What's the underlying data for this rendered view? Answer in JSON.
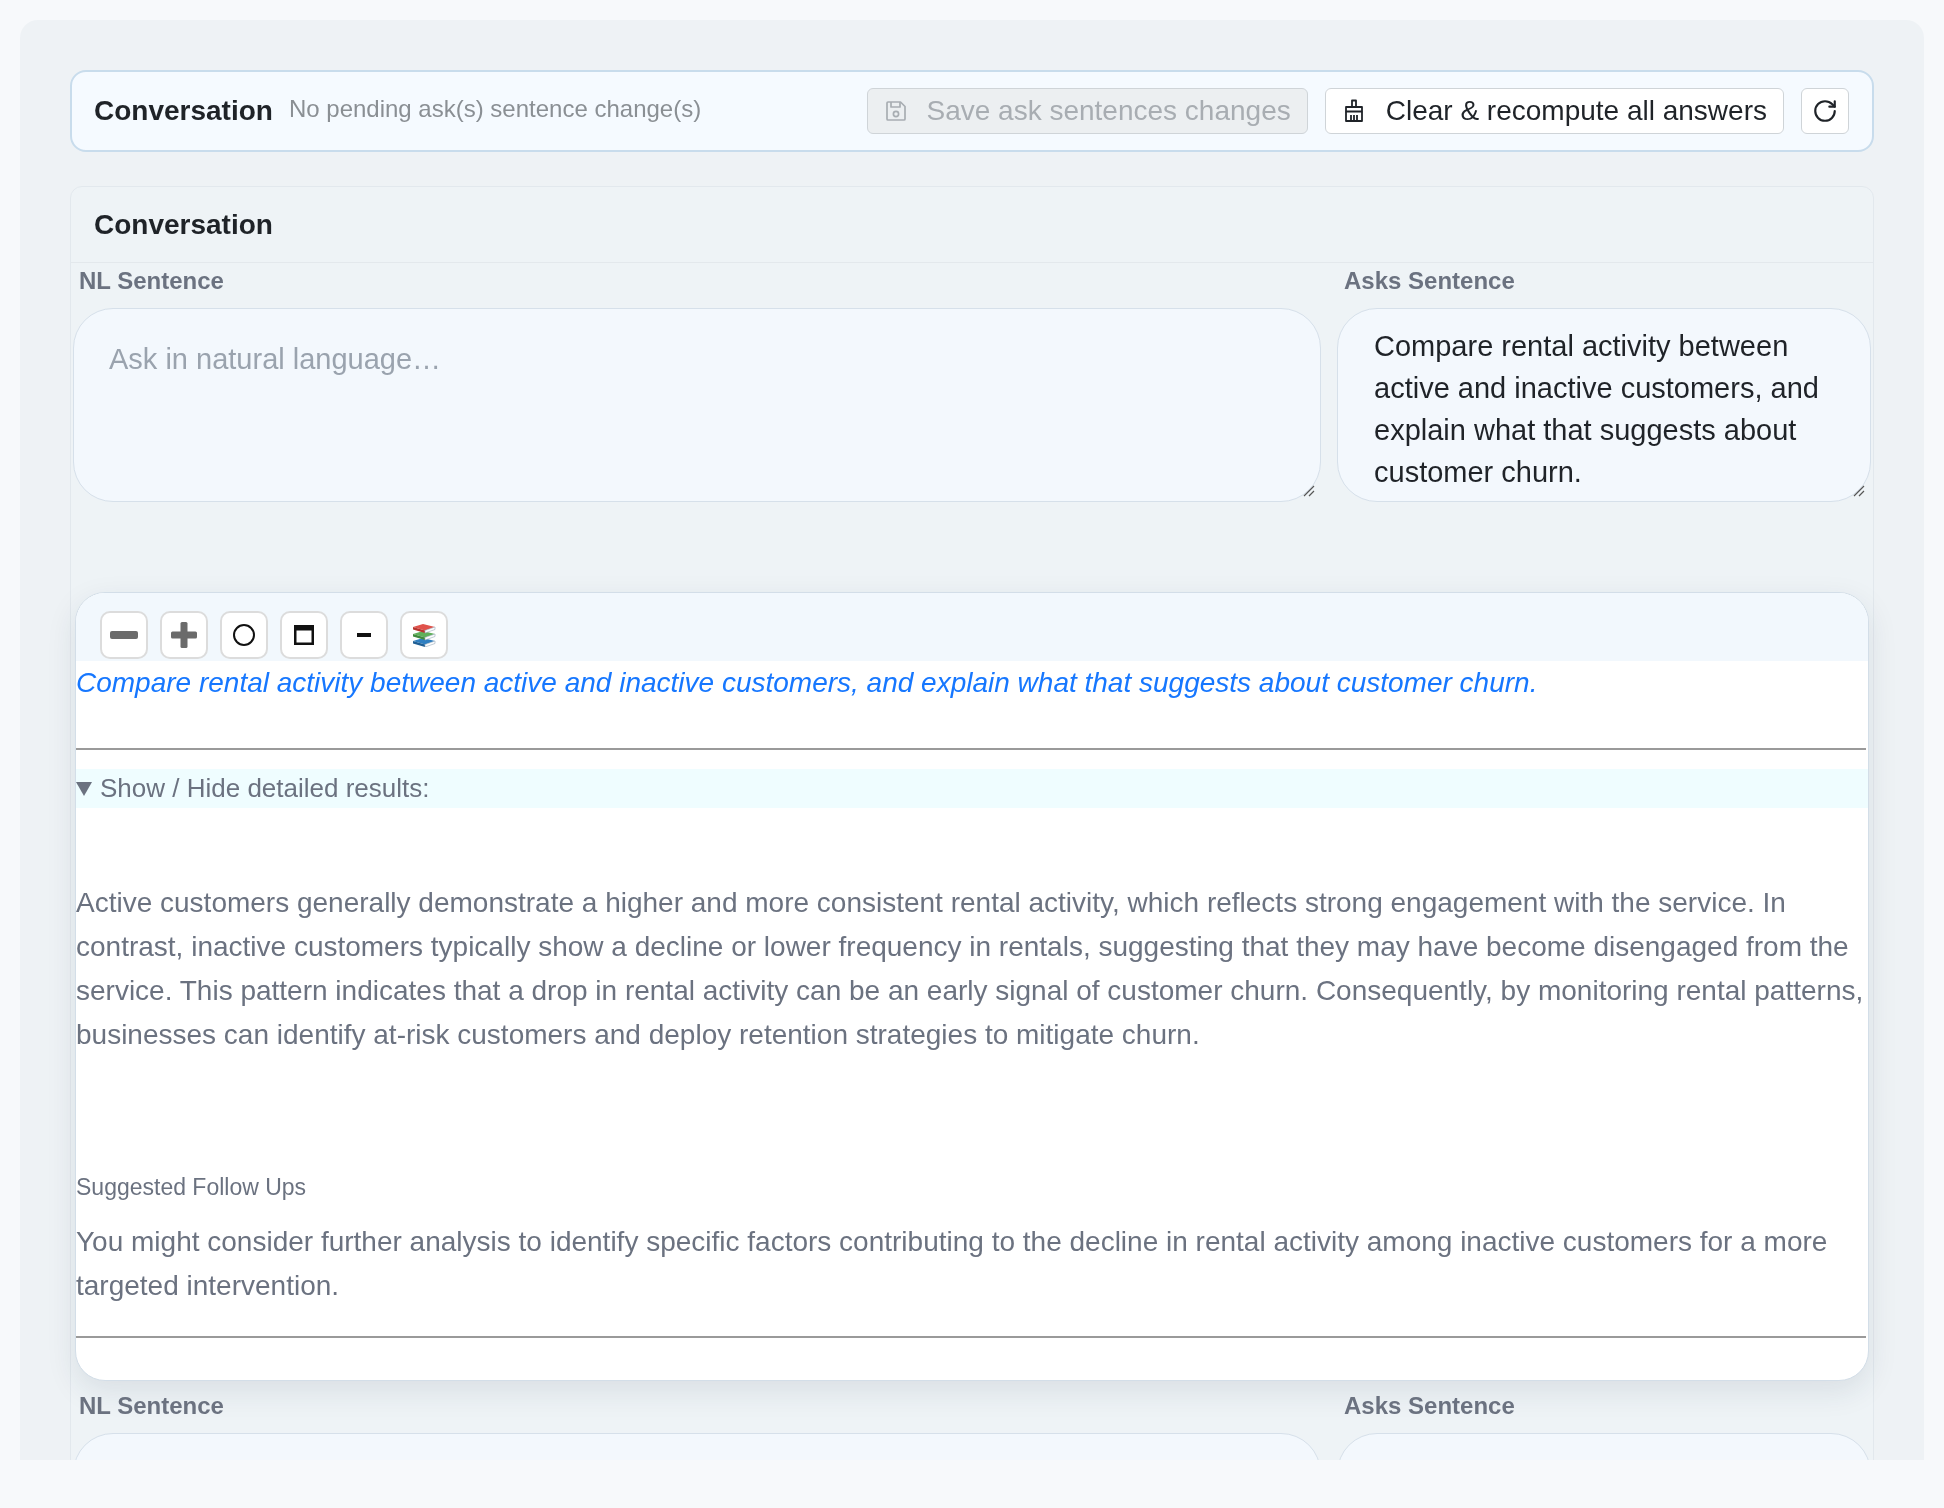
{
  "header": {
    "title": "Conversation",
    "status": "No pending ask(s) sentence change(s)",
    "buttons": [
      {
        "kind": "save",
        "label": "Save ask sentences changes",
        "disabled": true
      },
      {
        "kind": "clear",
        "label": "Clear & recompute all answers",
        "disabled": false
      },
      {
        "kind": "refresh",
        "disabled": false
      }
    ]
  },
  "conversation": {
    "title": "Conversation",
    "turns": [
      {
        "nl_label": "NL Sentence",
        "nl_placeholder": "Ask in natural language…",
        "asks_label": "Asks Sentence",
        "asks_value": "Compare rental activity between active and inactive customers, and explain what that suggests about customer churn.",
        "result": {
          "toolbar": [
            {
              "kind": "minus"
            },
            {
              "kind": "plus"
            },
            {
              "kind": "circle"
            },
            {
              "kind": "window"
            },
            {
              "kind": "dash"
            },
            {
              "kind": "books"
            }
          ],
          "question": "Compare rental activity between active and inactive customers, and explain what that suggests about customer churn.",
          "details": {
            "summary": "Show / Hide detailed results:",
            "expanded": true,
            "answer": "Active customers generally demonstrate a higher and more consistent rental activity, which reflects strong engagement with the service. In contrast, inactive customers typically show a decline or lower frequency in rentals, suggesting that they may have become disengaged from the service. This pattern indicates that a drop in rental activity can be an early signal of customer churn. Consequently, by monitoring rental patterns, businesses can identify at-risk customers and deploy retention strategies to mitigate churn.",
            "followups_title": "Suggested Follow Ups",
            "followups": "You might consider further analysis to identify specific factors contributing to the decline in rental activity among inactive customers for a more targeted intervention."
          }
        }
      },
      {
        "nl_label": "NL Sentence",
        "asks_label": "Asks Sentence"
      }
    ]
  }
}
